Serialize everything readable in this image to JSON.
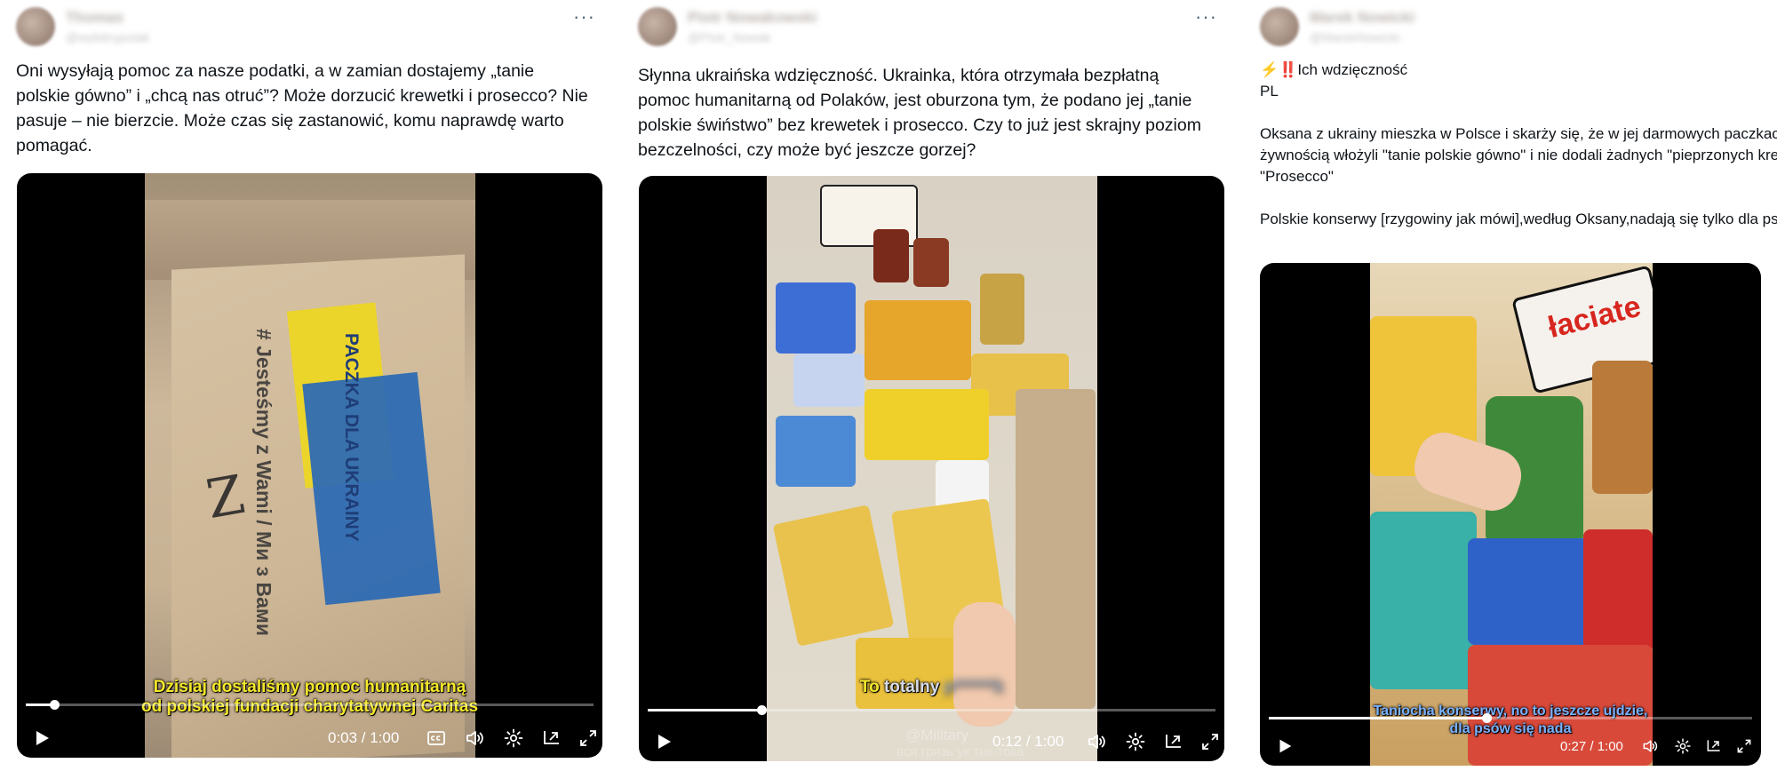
{
  "posts": [
    {
      "more_label": "···",
      "name": "Thomas",
      "handle": "@wybitnypolak",
      "text": "Oni wysyłają pomoc za nasze podatki, a w zamian dostajemy „tanie polskie gówno” i „chcą nas otruć”? Może dorzucić krewetki i prosecco? Nie pasuje – nie bierzcie. Może czas się zastanowić, komu naprawdę warto pomagać.",
      "video": {
        "box_print_left": "# Jesteśmy z Wami / Ми з Вами",
        "box_print_right": "PACZKA DLA UKRAINY",
        "box_scribble": "Z",
        "caption_line1": "Dzisiaj dostaliśmy pomoc humanitarną",
        "caption_line2": "od polskiej fundacji charytatywnej Caritas",
        "time": "0:03 / 1:00",
        "progress": 0.05,
        "has_cc": true
      }
    },
    {
      "more_label": "···",
      "name": "Piotr Nowakowski",
      "handle": "@Piotr_Nowak",
      "text": "Słynna ukraińska wdzięczność. Ukrainka, która otrzymała bezpłatną pomoc humanitarną od Polaków,  jest oburzona tym, że podano jej „tanie polskie świństwo” bez krewetek i prosecco. Czy to już jest skrajny poziom bezczelności, czy może być jeszcze gorzej?",
      "video": {
        "caption_lead": "To",
        "caption_word": "totalny",
        "caption_blurred": "p******k",
        "watermark": "@Military",
        "watermark2": "вся грязь ук  тик-тока",
        "time": "0:12 / 1:00",
        "progress": 0.2,
        "has_cc": false
      }
    },
    {
      "more_label": "···",
      "name": "Marek Nowicki",
      "handle": "@MarekNowicki",
      "text": "⚡‼️Ich wdzięczność\nPL\n\nOksana z ukrainy mieszka w Polsce i skarży się, że w jej darmowych paczkach z żywnością włożyli \"tanie polskie gówno\" i nie dodali żadnych \"pieprzonych krewetek\" i \"Prosecco\"\n\nPolskie konserwy [rzygowiny jak mówi],według Oksany,nadają się tylko dla psów",
      "video": {
        "pack_label": "łaciate",
        "caption_line1": "Taniocha konserwy, no to jeszcze ujdzie,",
        "caption_line2": "dla psów się nada",
        "time": "0:27 / 1:00",
        "progress": 0.45,
        "has_cc": false
      }
    }
  ],
  "icons": [
    "ellipsis-icon",
    "play-icon",
    "cc-icon",
    "volume-icon",
    "settings-icon",
    "pip-icon",
    "fullscreen-icon"
  ]
}
